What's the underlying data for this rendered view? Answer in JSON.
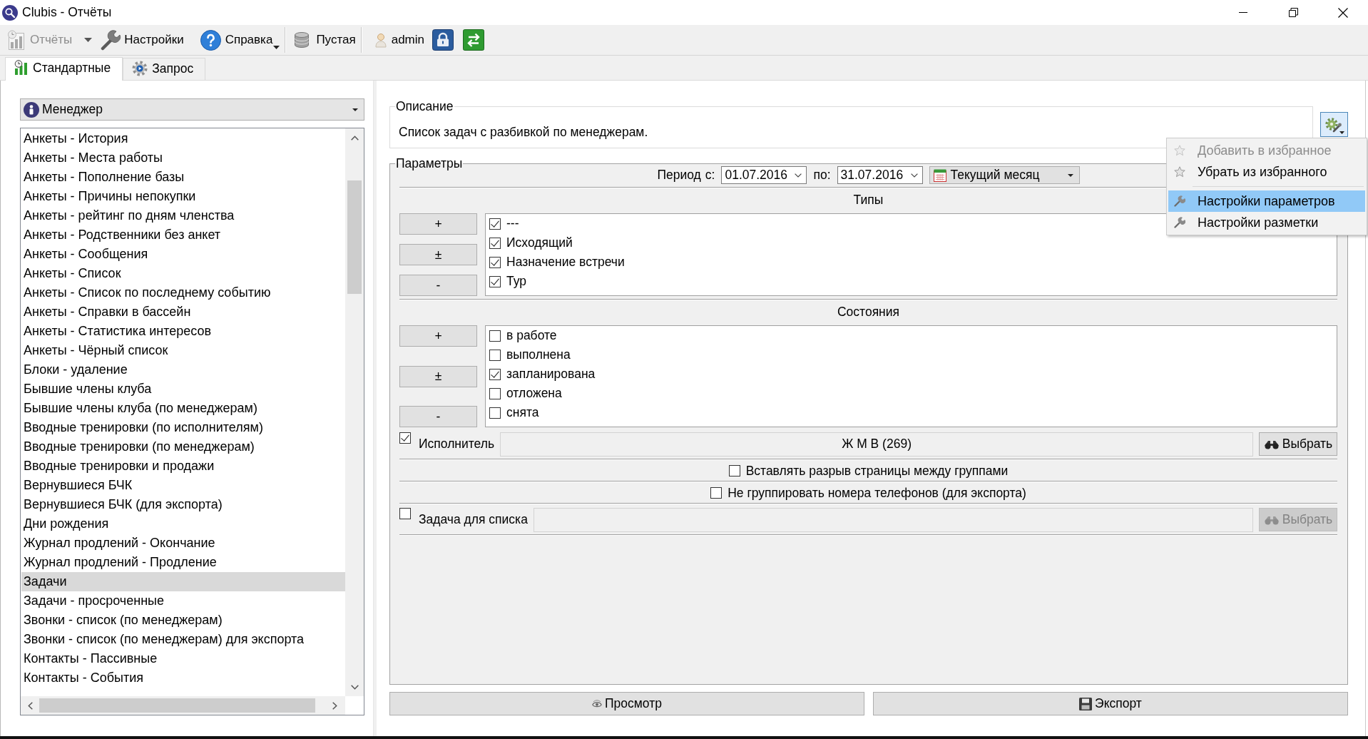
{
  "window": {
    "title": "Clubis - Отчёты"
  },
  "toolbar": {
    "reports": {
      "label": "Отчёты",
      "disabled": true
    },
    "settings": {
      "label": "Настройки"
    },
    "help": {
      "label": "Справка"
    },
    "database": {
      "label": "Пустая"
    },
    "user": {
      "label": "admin"
    }
  },
  "tabs": [
    {
      "label": "Стандартные",
      "selected": true
    },
    {
      "label": "Запрос",
      "selected": false
    }
  ],
  "report_group": {
    "value": "Менеджер"
  },
  "report_list": {
    "items": [
      {
        "label": "Анкеты - История",
        "selected": false
      },
      {
        "label": "Анкеты - Места работы",
        "selected": false
      },
      {
        "label": "Анкеты - Пополнение базы",
        "selected": false
      },
      {
        "label": "Анкеты - Причины непокупки",
        "selected": false
      },
      {
        "label": "Анкеты - рейтинг по дням членства",
        "selected": false
      },
      {
        "label": "Анкеты - Родственники без анкет",
        "selected": false
      },
      {
        "label": "Анкеты - Сообщения",
        "selected": false
      },
      {
        "label": "Анкеты - Список",
        "selected": false
      },
      {
        "label": "Анкеты - Список по последнему событию",
        "selected": false
      },
      {
        "label": "Анкеты - Справки в бассейн",
        "selected": false
      },
      {
        "label": "Анкеты - Статистика интересов",
        "selected": false
      },
      {
        "label": "Анкеты - Чёрный список",
        "selected": false
      },
      {
        "label": "Блоки - удаление",
        "selected": false
      },
      {
        "label": "Бывшие члены клуба",
        "selected": false
      },
      {
        "label": "Бывшие члены клуба (по менеджерам)",
        "selected": false
      },
      {
        "label": "Вводные тренировки (по исполнителям)",
        "selected": false
      },
      {
        "label": "Вводные тренировки (по менеджерам)",
        "selected": false
      },
      {
        "label": "Вводные тренировки и продажи",
        "selected": false
      },
      {
        "label": "Вернувшиеся БЧК",
        "selected": false
      },
      {
        "label": "Вернувшиеся БЧК (для экспорта)",
        "selected": false
      },
      {
        "label": "Дни рождения",
        "selected": false
      },
      {
        "label": "Журнал продлений - Окончание",
        "selected": false
      },
      {
        "label": "Журнал продлений - Продление",
        "selected": false
      },
      {
        "label": "Задачи",
        "selected": true
      },
      {
        "label": "Задачи - просроченные",
        "selected": false
      },
      {
        "label": "Звонки - список (по менеджерам)",
        "selected": false
      },
      {
        "label": "Звонки - список (по менеджерам) для экспорта",
        "selected": false
      },
      {
        "label": "Контакты - Пассивные",
        "selected": false
      },
      {
        "label": "Контакты - События",
        "selected": false
      }
    ]
  },
  "description": {
    "title": "Описание",
    "text": "Список задач с разбивкой по менеджерам."
  },
  "options_menu": {
    "groups": [
      {
        "items": [
          {
            "label": "Добавить в избранное",
            "disabled": true,
            "selected": false
          },
          {
            "label": "Убрать из избранного",
            "disabled": false,
            "selected": false
          }
        ]
      },
      {
        "items": [
          {
            "label": "Настройки параметров",
            "disabled": false,
            "selected": true
          },
          {
            "label": "Настройки разметки",
            "disabled": false,
            "selected": false
          }
        ]
      }
    ]
  },
  "parameters": {
    "title": "Параметры",
    "period": {
      "label": "Период",
      "from_label": "с:",
      "from": "01.07.2016",
      "to_label": "по:",
      "to": "31.07.2016",
      "preset": "Текущий месяц"
    },
    "groups": [
      {
        "title": "Типы",
        "buttons": [
          "+",
          "±",
          "-"
        ],
        "items": [
          {
            "label": "---",
            "checked": true
          },
          {
            "label": "Исходящий",
            "checked": true
          },
          {
            "label": "Назначение встречи",
            "checked": true
          },
          {
            "label": "Тур",
            "checked": true
          }
        ]
      },
      {
        "title": "Состояния",
        "buttons": [
          "+",
          "±",
          "-"
        ],
        "items": [
          {
            "label": "в работе",
            "checked": false
          },
          {
            "label": "выполнена",
            "checked": false
          },
          {
            "label": "запланирована",
            "checked": true
          },
          {
            "label": "отложена",
            "checked": false
          },
          {
            "label": "снята",
            "checked": false
          }
        ]
      }
    ],
    "rows": [
      {
        "kind": "picker",
        "label": "Исполнитель",
        "checked": true,
        "value": "Ж М В (269)",
        "button": {
          "label": "Выбрать",
          "disabled": false
        }
      },
      {
        "kind": "option",
        "label": "Вставлять разрыв страницы между группами",
        "checked": false
      },
      {
        "kind": "option",
        "label": "Не группировать номера телефонов (для экспорта)",
        "checked": false
      },
      {
        "kind": "picker",
        "label": "Задача для списка",
        "checked": false,
        "button": {
          "label": "Выбрать",
          "disabled": true
        }
      }
    ]
  },
  "actions": [
    "Просмотр",
    "Экспорт"
  ]
}
